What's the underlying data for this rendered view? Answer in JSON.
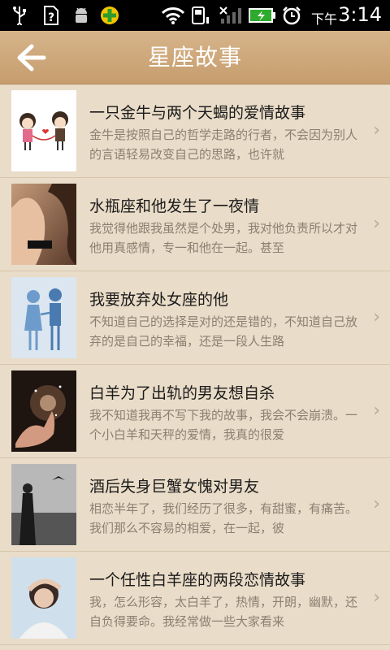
{
  "status_bar": {
    "ampm": "下午",
    "time": "3:14",
    "icons": [
      "usb-icon",
      "sim-alert-icon",
      "android-debug-icon",
      "app-plus-icon",
      "wifi-icon",
      "phone-icon",
      "signal-icon",
      "battery-charging-icon",
      "alarm-icon"
    ]
  },
  "header": {
    "title": "星座故事",
    "back_icon": "back-arrow-icon"
  },
  "stories": [
    {
      "title": "一只金牛与两个天蝎的爱情故事",
      "desc": "金牛是按照自己的哲学走路的行者，不会因为别人的言语轻易改变自己的思路，也许就"
    },
    {
      "title": "水瓶座和他发生了一夜情",
      "desc": "我觉得他跟我虽然是个处男，我对他负责所以才对他用真感情，专一和他在一起。甚至"
    },
    {
      "title": "我要放弃处女座的他",
      "desc": "不知道自己的选择是对的还是错的，不知道自己放弃的是自己的幸福，还是一段人生路"
    },
    {
      "title": "白羊为了出轨的男友想自杀",
      "desc": "我不知道我再不写下我的故事，我会不会崩溃。一个小白羊和天秤的爱情，我真的很爱"
    },
    {
      "title": "酒后失身巨蟹女愧对男友",
      "desc": "相恋半年了，我们经历了很多，有甜蜜，有痛苦。我们那么不容易的相爱，在一起，彼"
    },
    {
      "title": "一个任性白羊座的两段恋情故事",
      "desc": "我，怎么形容，太白羊了，热情，开朗，幽默，还自负得要命。我经常做一些大家看来"
    }
  ],
  "colors": {
    "header": "#c9a070",
    "background": "#e9dcc8",
    "desc_text": "#8c7f72"
  }
}
